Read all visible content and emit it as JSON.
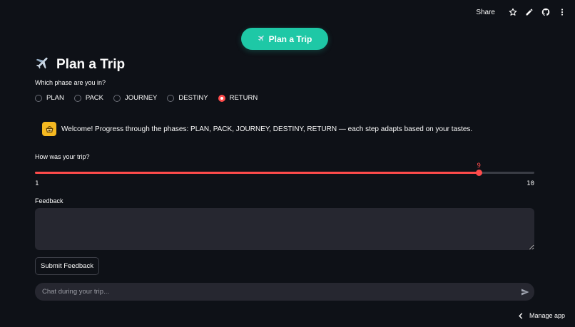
{
  "toolbar": {
    "share_label": "Share",
    "icons": [
      "star-icon",
      "pencil-icon",
      "github-icon",
      "more-vertical-icon"
    ]
  },
  "top_button": {
    "label": "Plan a Trip",
    "icon": "airplane-icon"
  },
  "page_title": {
    "text": "Plan a Trip",
    "icon": "airplane-icon"
  },
  "phase": {
    "question": "Which phase are you in?",
    "options": [
      "PLAN",
      "PACK",
      "JOURNEY",
      "DESTINY",
      "RETURN"
    ],
    "selected": "RETURN"
  },
  "welcome": {
    "icon": "picnic-basket-icon",
    "text": "Welcome! Progress through the phases: PLAN, PACK, JOURNEY, DESTINY, RETURN — each step adapts based on your tastes."
  },
  "rating": {
    "label": "How was your trip?",
    "min": 1,
    "max": 10,
    "value": 9,
    "min_label": "1",
    "max_label": "10",
    "value_label": "9"
  },
  "feedback": {
    "label": "Feedback",
    "value": ""
  },
  "submit": {
    "label": "Submit Feedback"
  },
  "chat": {
    "placeholder": "Chat during your trip...",
    "send_icon": "send-icon"
  },
  "manage": {
    "label": "Manage app",
    "icon": "chevron-left-icon"
  },
  "colors": {
    "background": "#0e1117",
    "accent_red": "#ff4b4b",
    "teal_button": "#1ec8a6",
    "input_bg": "#262730",
    "welcome_icon_bg": "#f5b921"
  }
}
